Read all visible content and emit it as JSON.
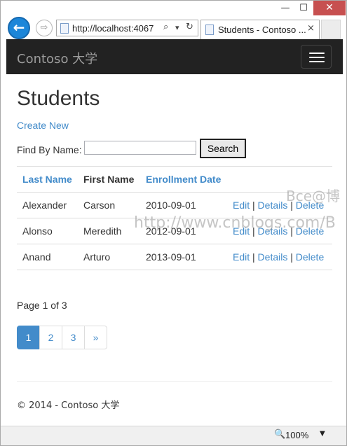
{
  "window": {
    "minimize_glyph": "—",
    "maximize_glyph": "☐",
    "close_glyph": "✕"
  },
  "browser": {
    "address": "http://localhost:4067",
    "tab_title": "Students - Contoso ...",
    "search_glyph": "⌕",
    "dropdown_glyph": "▾",
    "refresh_glyph": "↻",
    "tab_close_glyph": "×",
    "back_glyph": "←",
    "forward_glyph": "⇨"
  },
  "navbar": {
    "brand": "Contoso 大学"
  },
  "page": {
    "title": "Students",
    "create_new": "Create New",
    "find_label": "Find By Name:",
    "find_value": "",
    "search_button": "Search",
    "columns": [
      "Last Name",
      "First Name",
      "Enrollment Date"
    ],
    "rows": [
      {
        "last": "Alexander",
        "first": "Carson",
        "date": "2010-09-01"
      },
      {
        "last": "Alonso",
        "first": "Meredith",
        "date": "2012-09-01"
      },
      {
        "last": "Anand",
        "first": "Arturo",
        "date": "2013-09-01"
      }
    ],
    "row_actions": {
      "edit": "Edit",
      "details": "Details",
      "delete": "Delete",
      "separator": "|"
    },
    "page_info": "Page 1 of 3",
    "pager": [
      "1",
      "2",
      "3",
      "»"
    ],
    "active_page": "1",
    "footer": "© 2014 - Contoso 大学"
  },
  "watermark": {
    "line1": "Bce@博",
    "line2": "http://www.cnblogs.com/B"
  },
  "statusbar": {
    "zoom": "100%",
    "zoom_glyph": "🔍",
    "zoom_arrow": "▼"
  },
  "colors": {
    "link": "#428bca",
    "navbar": "#222222",
    "close_button": "#c75050",
    "back_button": "#1c86d9"
  }
}
